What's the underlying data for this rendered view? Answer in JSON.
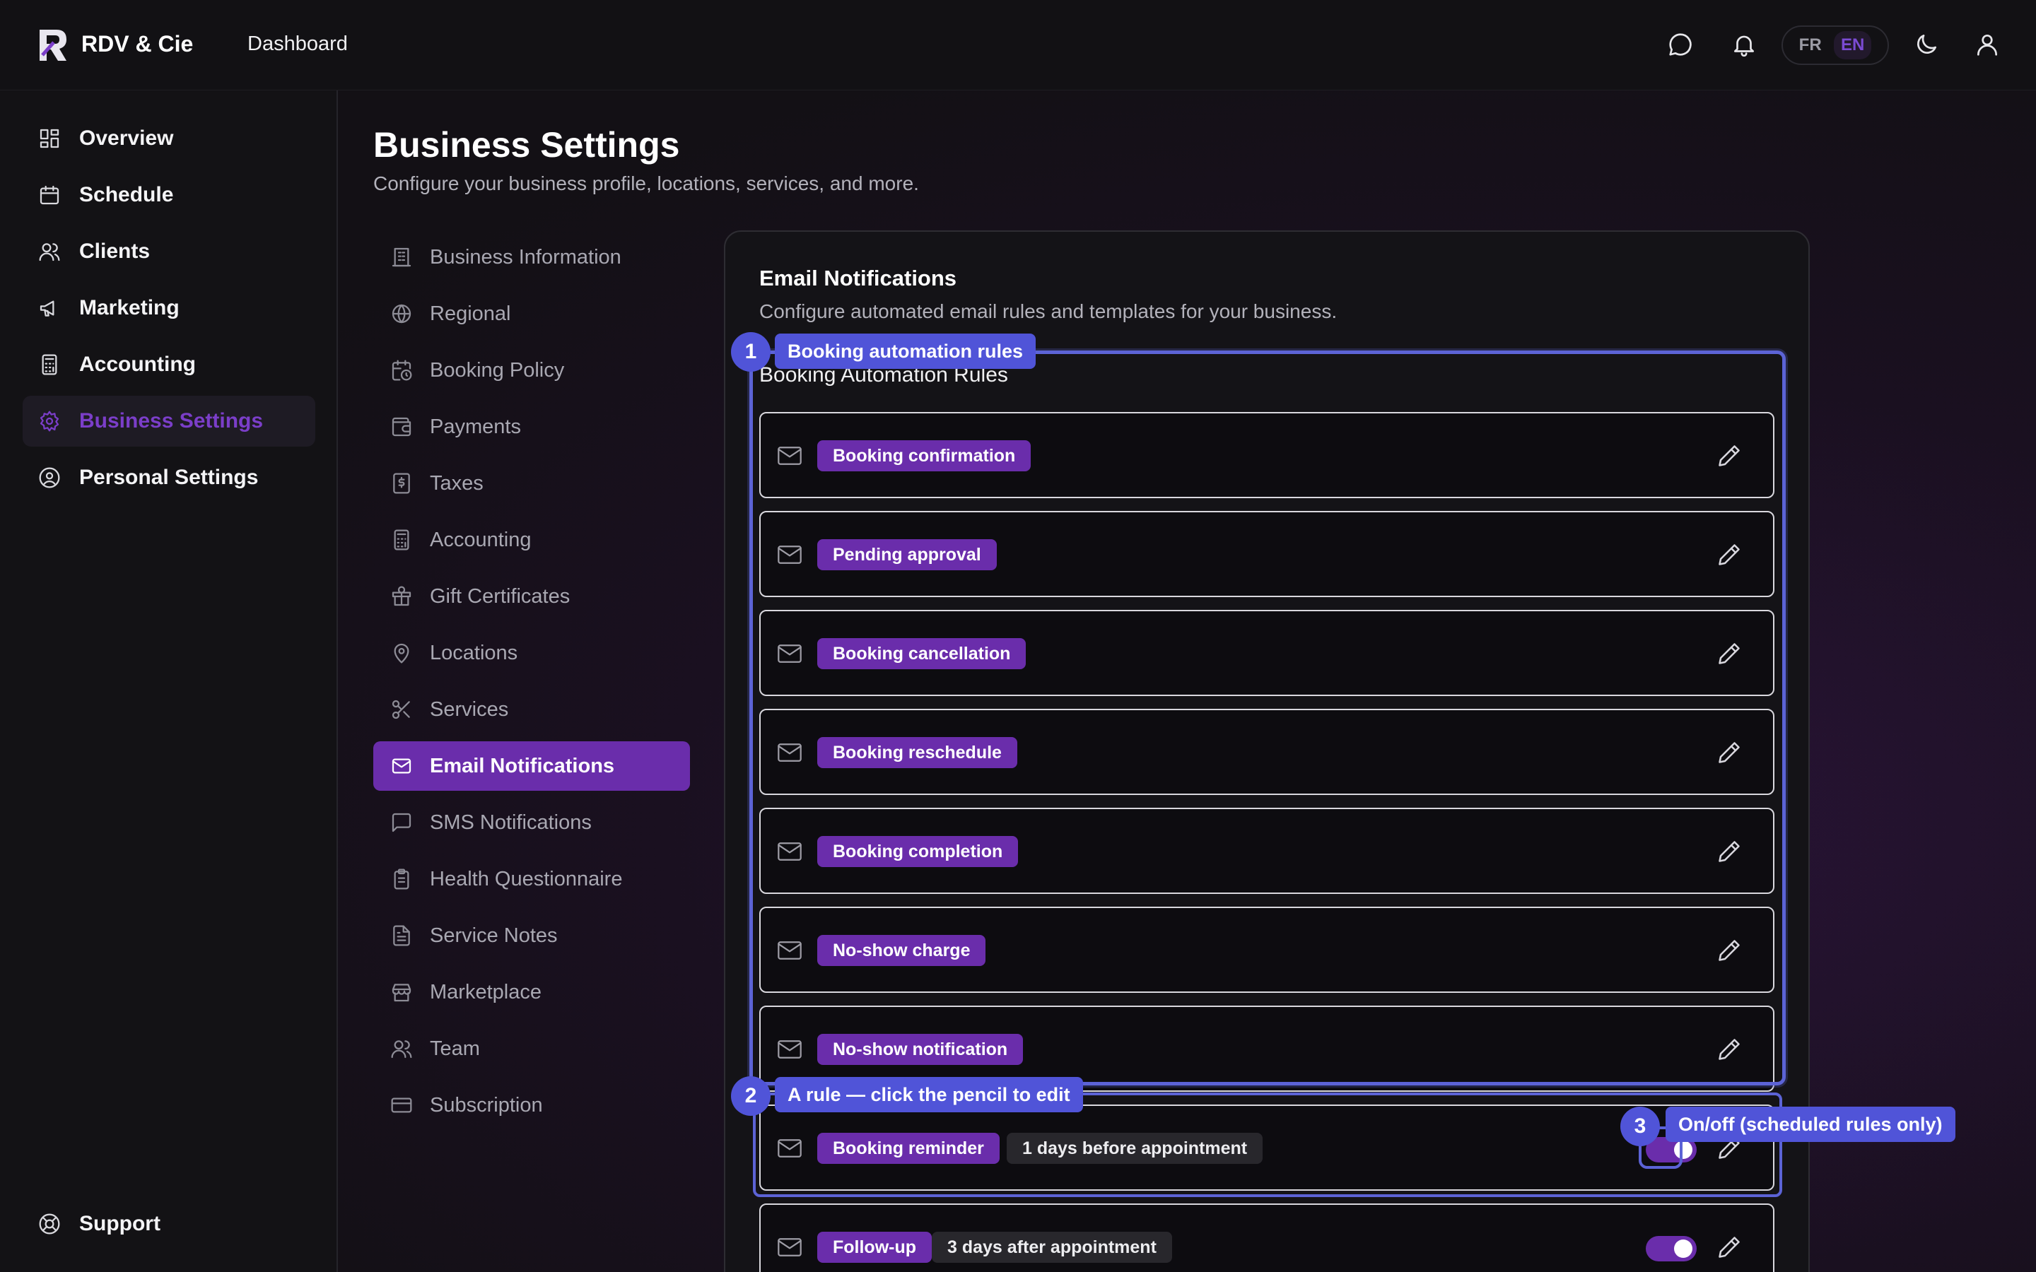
{
  "header": {
    "brand": "RDV & Cie",
    "breadcrumb": "Dashboard",
    "lang_fr": "FR",
    "lang_en": "EN"
  },
  "sidebar": {
    "items": [
      {
        "label": "Overview",
        "icon": "layout-grid-icon"
      },
      {
        "label": "Schedule",
        "icon": "calendar-icon"
      },
      {
        "label": "Clients",
        "icon": "users-icon"
      },
      {
        "label": "Marketing",
        "icon": "megaphone-icon"
      },
      {
        "label": "Accounting",
        "icon": "calculator-icon"
      },
      {
        "label": "Business Settings",
        "icon": "gear-icon",
        "active": true
      },
      {
        "label": "Personal Settings",
        "icon": "user-circle-icon"
      }
    ],
    "support": "Support"
  },
  "page": {
    "title": "Business Settings",
    "subtitle": "Configure your business profile, locations, services, and more."
  },
  "settings_nav": [
    {
      "label": "Business Information"
    },
    {
      "label": "Regional"
    },
    {
      "label": "Booking Policy"
    },
    {
      "label": "Payments"
    },
    {
      "label": "Taxes"
    },
    {
      "label": "Accounting"
    },
    {
      "label": "Gift Certificates"
    },
    {
      "label": "Locations"
    },
    {
      "label": "Services"
    },
    {
      "label": "Email Notifications",
      "active": true
    },
    {
      "label": "SMS Notifications"
    },
    {
      "label": "Health Questionnaire"
    },
    {
      "label": "Service Notes"
    },
    {
      "label": "Marketplace"
    },
    {
      "label": "Team"
    },
    {
      "label": "Subscription"
    }
  ],
  "card": {
    "title": "Email Notifications",
    "subtitle": "Configure automated email rules and templates for your business.",
    "section_title": "Booking Automation Rules",
    "rules": [
      {
        "label": "Booking confirmation",
        "timing": "",
        "toggle_on": null
      },
      {
        "label": "Pending approval",
        "timing": "",
        "toggle_on": null
      },
      {
        "label": "Booking cancellation",
        "timing": "",
        "toggle_on": null
      },
      {
        "label": "Booking reschedule",
        "timing": "",
        "toggle_on": null
      },
      {
        "label": "Booking completion",
        "timing": "",
        "toggle_on": null
      },
      {
        "label": "No-show charge",
        "timing": "",
        "toggle_on": null
      },
      {
        "label": "No-show notification",
        "timing": "",
        "toggle_on": null
      },
      {
        "label": "Booking reminder",
        "timing": "1 days before appointment",
        "toggle_on": true
      },
      {
        "label": "Follow-up",
        "timing": "3 days after appointment",
        "toggle_on": true
      }
    ]
  },
  "callouts": [
    {
      "num": "1",
      "label": "Booking automation rules"
    },
    {
      "num": "2",
      "label": "A rule — click the pencil to edit"
    },
    {
      "num": "3",
      "label": "On/off (scheduled rules only)"
    }
  ],
  "colors": {
    "accent": "#6a2dab",
    "callout": "#5054d8"
  }
}
